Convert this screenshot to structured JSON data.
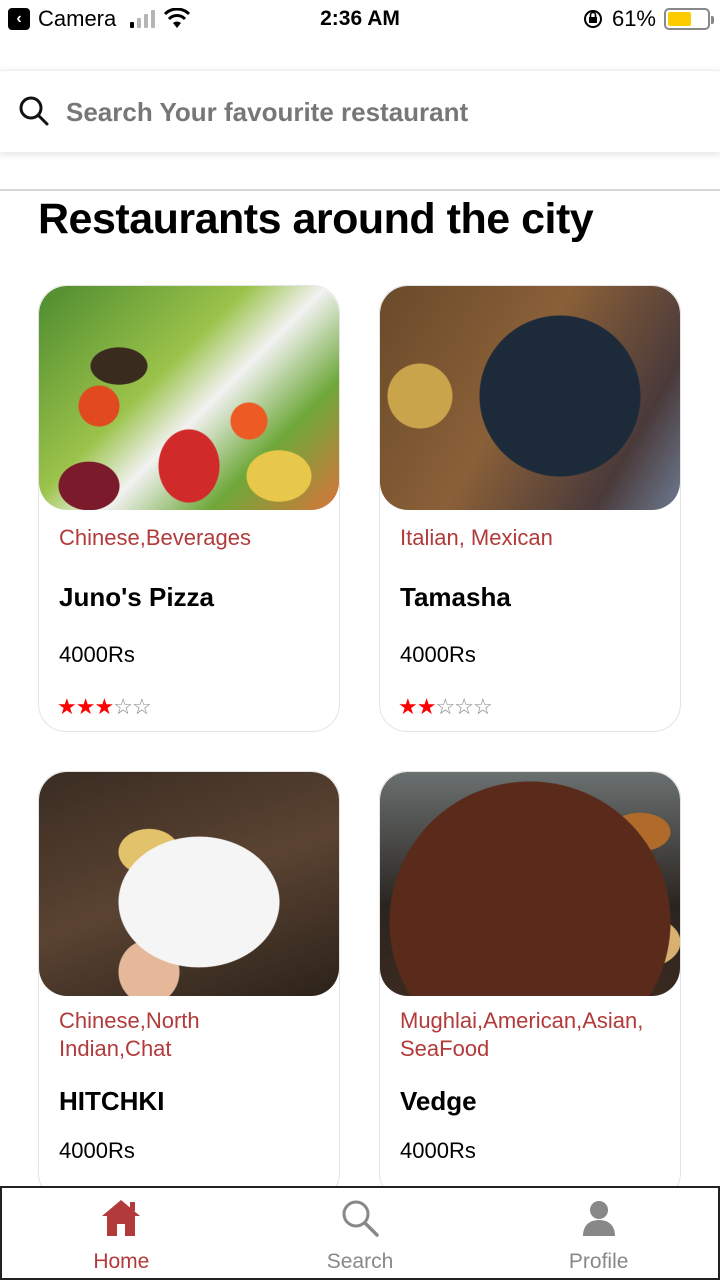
{
  "status_bar": {
    "back_app": "Camera",
    "time": "2:36 AM",
    "battery": "61%"
  },
  "search": {
    "placeholder": "Search Your favourite restaurant",
    "value": ""
  },
  "page_title": "Restaurants around the city",
  "restaurants": [
    {
      "cuisine": "Chinese,Beverages",
      "name": "Juno's Pizza",
      "price": "4000Rs",
      "rating": 3,
      "max_rating": 5
    },
    {
      "cuisine": "Italian, Mexican",
      "name": "Tamasha",
      "price": "4000Rs",
      "rating": 2,
      "max_rating": 5
    },
    {
      "cuisine": "Chinese,North Indian,Chat",
      "name": "HITCHKI",
      "price": "4000Rs"
    },
    {
      "cuisine": "Mughlai,American,Asian, SeaFood",
      "name": "Vedge",
      "price": "4000Rs"
    }
  ],
  "bottom_nav": {
    "items": [
      {
        "label": "Home",
        "icon": "home-icon",
        "active": true
      },
      {
        "label": "Search",
        "icon": "search-icon",
        "active": false
      },
      {
        "label": "Profile",
        "icon": "profile-icon",
        "active": false
      }
    ]
  },
  "colors": {
    "accent": "#b33a3a",
    "star_active": "#ff0000",
    "battery": "#ffcc00"
  }
}
